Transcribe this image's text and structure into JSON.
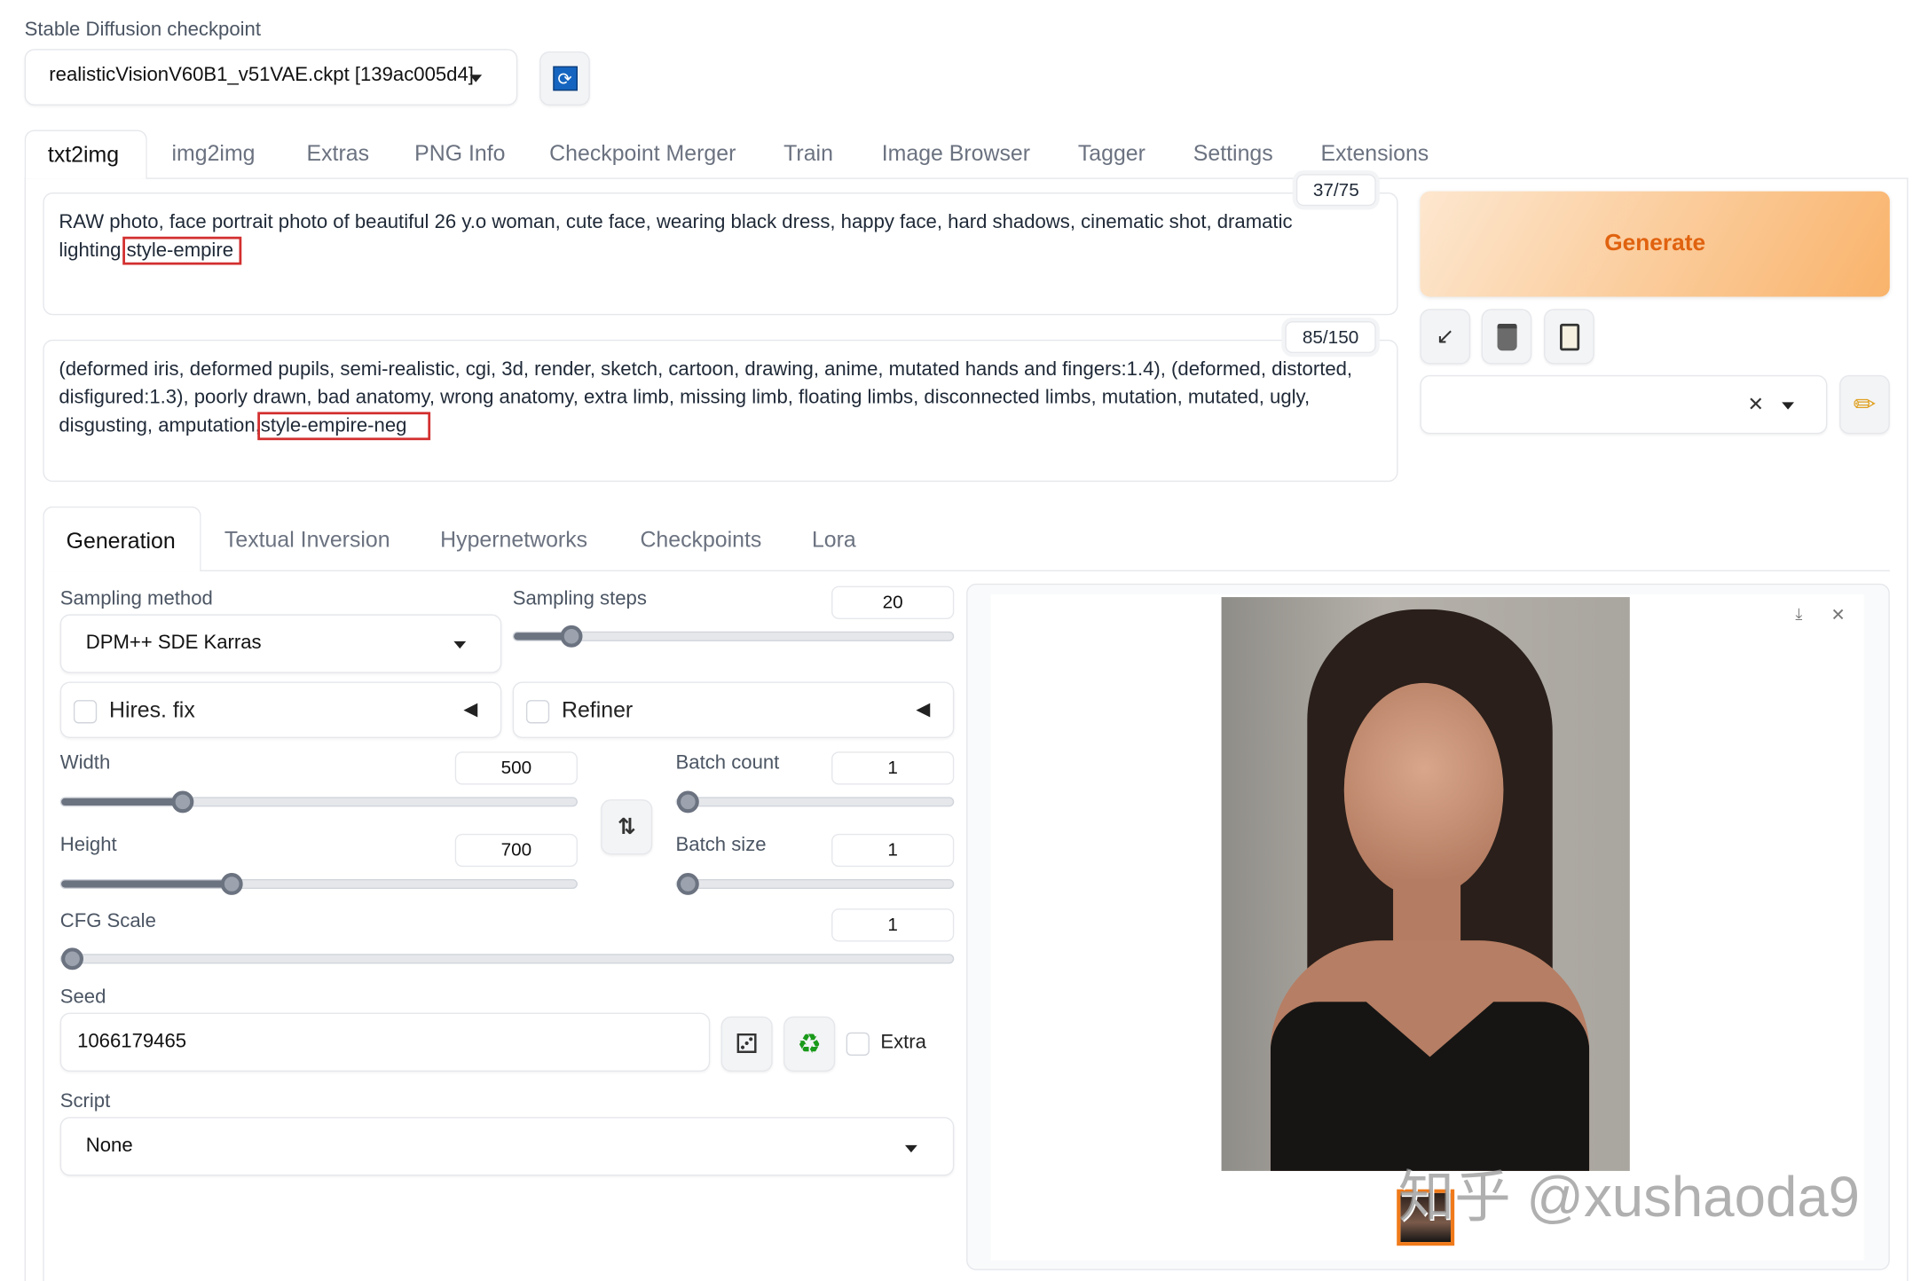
{
  "checkpoint": {
    "label": "Stable Diffusion checkpoint",
    "value": "realisticVisionV60B1_v51VAE.ckpt [139ac005d4]"
  },
  "main_tabs": [
    "txt2img",
    "img2img",
    "Extras",
    "PNG Info",
    "Checkpoint Merger",
    "Train",
    "Image Browser",
    "Tagger",
    "Settings",
    "Extensions"
  ],
  "prompt": {
    "text": "RAW photo, face portrait photo of beautiful 26 y.o woman, cute face, wearing black dress, happy face, hard shadows, cinematic shot, dramatic lighting,",
    "style": "style-empire",
    "counter": "37/75"
  },
  "negative": {
    "text": "(deformed iris, deformed pupils, semi-realistic, cgi, 3d, render, sketch, cartoon, drawing, anime, mutated hands and fingers:1.4), (deformed, distorted, disfigured:1.3), poorly drawn, bad anatomy, wrong anatomy, extra limb, missing limb, floating limbs, disconnected limbs, mutation, mutated, ugly, disgusting, amputation,",
    "style": "style-empire-neg",
    "counter": "85/150"
  },
  "generate_label": "Generate",
  "sub_tabs": [
    "Generation",
    "Textual Inversion",
    "Hypernetworks",
    "Checkpoints",
    "Lora"
  ],
  "params": {
    "sampling_method": {
      "label": "Sampling method",
      "value": "DPM++ SDE Karras"
    },
    "sampling_steps": {
      "label": "Sampling steps",
      "value": "20",
      "fraction": 0.13
    },
    "hires_fix": "Hires. fix",
    "refiner": "Refiner",
    "width": {
      "label": "Width",
      "value": "500",
      "fraction": 0.235
    },
    "height": {
      "label": "Height",
      "value": "700",
      "fraction": 0.33
    },
    "batch_count": {
      "label": "Batch count",
      "value": "1",
      "fraction": 0.0
    },
    "batch_size": {
      "label": "Batch size",
      "value": "1",
      "fraction": 0.0
    },
    "cfg_scale": {
      "label": "CFG Scale",
      "value": "1",
      "fraction": 0.0
    },
    "seed": {
      "label": "Seed",
      "value": "1066179465",
      "extra": "Extra"
    },
    "script": {
      "label": "Script",
      "value": "None"
    }
  },
  "watermark": "知乎 @xushaoda9",
  "colors": {
    "accent": "#f97316",
    "generate_text": "#e0620f",
    "highlight_box": "#d32f2f"
  }
}
